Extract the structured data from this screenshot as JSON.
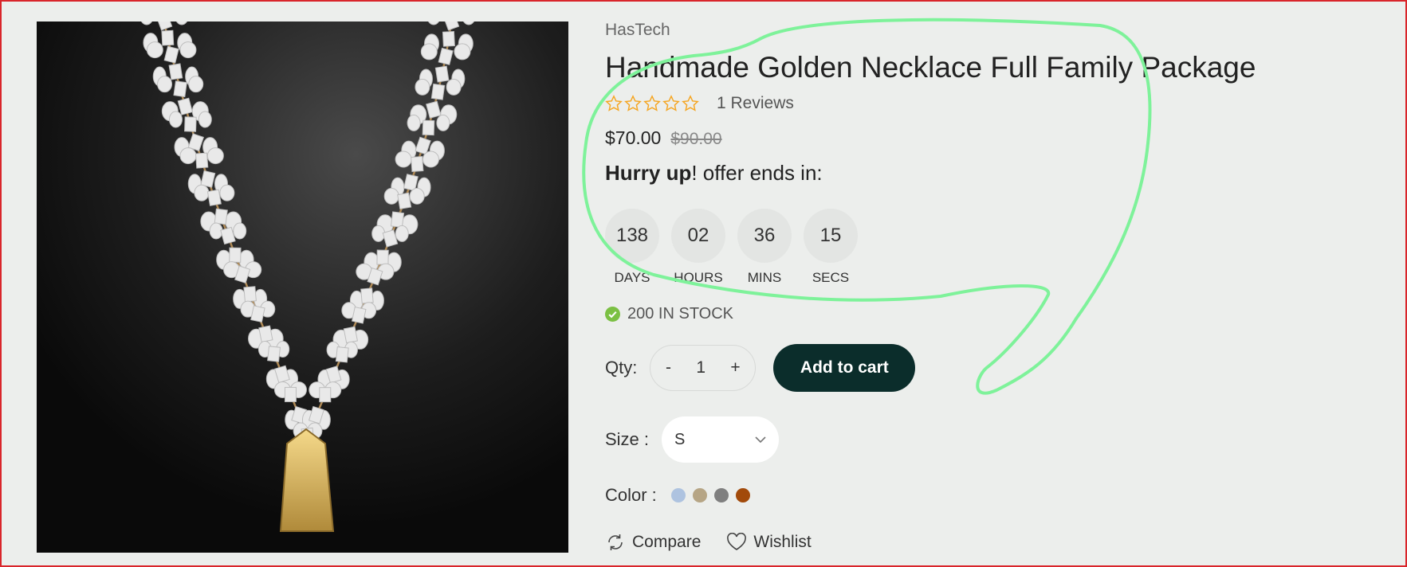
{
  "product": {
    "brand": "HasTech",
    "title": "Handmade Golden Necklace Full Family Package",
    "rating_stars": 0,
    "reviews": "1 Reviews",
    "price": "$70.00",
    "old_price": "$90.00",
    "offer_bold": "Hurry up",
    "offer_rest": "! offer ends in:",
    "image_icon": "necklace-product-image"
  },
  "countdown": [
    {
      "value": "138",
      "label": "DAYS"
    },
    {
      "value": "02",
      "label": "HOURS"
    },
    {
      "value": "36",
      "label": "MINS"
    },
    {
      "value": "15",
      "label": "SECS"
    }
  ],
  "stock": {
    "text": "200 IN STOCK",
    "icon": "check-circle-icon",
    "color": "#7bc043"
  },
  "quantity": {
    "label": "Qty:",
    "minus": "-",
    "value": "1",
    "plus": "+"
  },
  "add_to_cart": {
    "label": "Add to cart",
    "color": "#0b2d2b"
  },
  "size": {
    "label": "Size :",
    "selected": "S"
  },
  "color": {
    "label": "Color :",
    "swatches": [
      "#aec3e0",
      "#b6a585",
      "#7f7f7f",
      "#a24a0a"
    ]
  },
  "actions": {
    "compare": "Compare",
    "wishlist": "Wishlist"
  },
  "colors": {
    "star": "#f5a623",
    "annotation": "#7ef29a",
    "frame": "#d9252b"
  }
}
